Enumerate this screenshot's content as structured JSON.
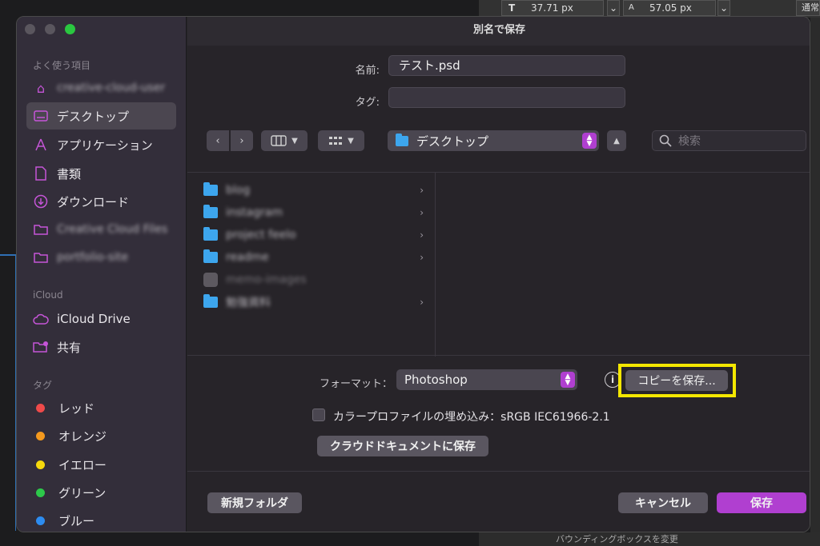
{
  "background": {
    "font_size_value": "37.71 px",
    "leading_value": "57.05 px",
    "blend_label": "通常",
    "bottom_label": "バウンディングボックスを変更"
  },
  "dialog": {
    "title": "別名で保存",
    "name_label": "名前:",
    "name_value": "テスト.psd",
    "tag_label": "タグ:",
    "tag_value": "",
    "location": "デスクトップ",
    "search_placeholder": "検索",
    "format_label": "フォーマット：",
    "format_value": "Photoshop",
    "save_copy_label": "コピーを保存...",
    "embed_profile_label": "カラープロファイルの埋め込み：sRGB IEC61966-2.1",
    "cloud_save_label": "クラウドドキュメントに保存",
    "new_folder_label": "新規フォルダ",
    "cancel_label": "キャンセル",
    "save_label": "保存"
  },
  "sidebar": {
    "favorites_head": "よく使う項目",
    "favorites": [
      {
        "label": "creative-cloud-user",
        "icon": "home-icon",
        "blurred": true
      },
      {
        "label": "デスクトップ",
        "icon": "desktop-icon",
        "selected": true
      },
      {
        "label": "アプリケーション",
        "icon": "applications-icon"
      },
      {
        "label": "書類",
        "icon": "document-icon"
      },
      {
        "label": "ダウンロード",
        "icon": "download-icon"
      },
      {
        "label": "Creative Cloud Files",
        "icon": "folder-icon",
        "blurred": true
      },
      {
        "label": "portfolio-site",
        "icon": "folder-icon",
        "blurred": true
      }
    ],
    "icloud_head": "iCloud",
    "icloud": [
      {
        "label": "iCloud Drive",
        "icon": "cloud-icon"
      },
      {
        "label": "共有",
        "icon": "shared-folder-icon"
      }
    ],
    "tags_head": "タグ",
    "tags": [
      {
        "label": "レッド",
        "color": "#ef4a4a"
      },
      {
        "label": "オレンジ",
        "color": "#f4991e"
      },
      {
        "label": "イエロー",
        "color": "#f6d90c"
      },
      {
        "label": "グリーン",
        "color": "#2dc84a"
      },
      {
        "label": "ブルー",
        "color": "#2d8cf0"
      }
    ]
  },
  "files": [
    {
      "name": "blog",
      "type": "folder",
      "has_children": true
    },
    {
      "name": "instagram",
      "type": "folder",
      "has_children": true
    },
    {
      "name": "project feelo",
      "type": "folder",
      "has_children": true
    },
    {
      "name": "readme",
      "type": "folder",
      "has_children": true
    },
    {
      "name": "memo-images",
      "type": "app",
      "has_children": false
    },
    {
      "name": "勉強資料",
      "type": "folder",
      "has_children": true
    }
  ],
  "colors": {
    "accent": "#b03fd0",
    "highlight": "#f4e700"
  }
}
